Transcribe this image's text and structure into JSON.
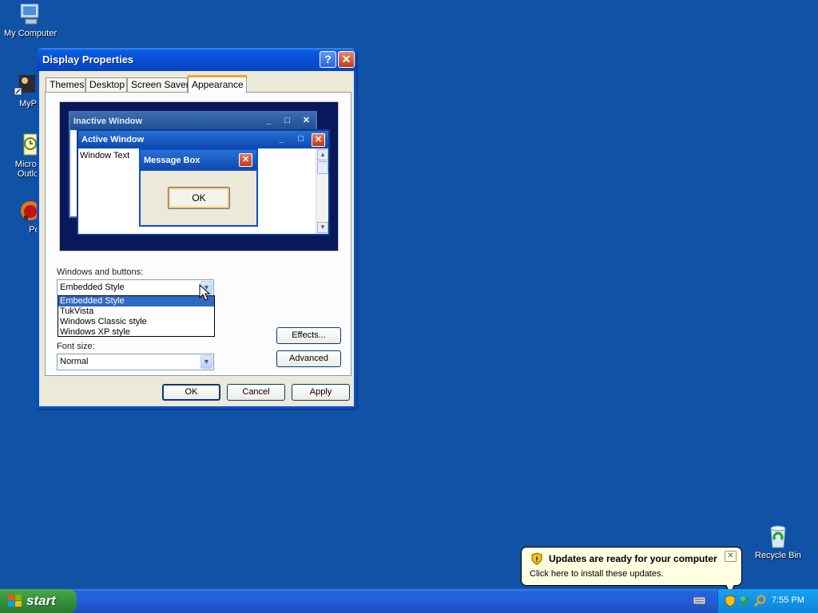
{
  "desktop": {
    "icons": [
      {
        "label": "My Computer",
        "icon": "computer-icon"
      },
      {
        "label": "MyPa",
        "icon": "user-icon"
      },
      {
        "label": "Micros Outlo",
        "icon": "outlook-icon"
      },
      {
        "label": "Peg",
        "icon": "game-icon"
      },
      {
        "label": "Recycle Bin",
        "icon": "recycle-bin-icon"
      }
    ]
  },
  "window": {
    "title": "Display Properties",
    "help_glyph": "?",
    "close_glyph": "✕",
    "tabs": [
      "Themes",
      "Desktop",
      "Screen Saver",
      "Appearance"
    ],
    "active_tab": "Appearance",
    "preview": {
      "inactive_title": "Inactive Window",
      "active_title": "Active Window",
      "window_text": "Window Text",
      "message_title": "Message Box",
      "ok_label": "OK"
    },
    "windows_and_buttons_label": "Windows and buttons:",
    "windows_and_buttons_value": "Embedded Style",
    "dropdown_options": [
      "Embedded Style",
      "TukVista",
      "Windows Classic style",
      "Windows XP style"
    ],
    "selected_option": "Embedded Style",
    "font_size_label": "Font size:",
    "font_size_value": "Normal",
    "effects_label": "Effects...",
    "advanced_label": "Advanced",
    "ok_label": "OK",
    "cancel_label": "Cancel",
    "apply_label": "Apply"
  },
  "taskbar": {
    "start_label": "start",
    "clock": "7:55 PM"
  },
  "balloon": {
    "title": "Updates are ready for your computer",
    "text": "Click here to install these updates.",
    "close_glyph": "✕"
  },
  "colors": {
    "desktop": "#0f52a6",
    "titlebar": "#0751d8",
    "taskbar": "#245edb",
    "start": "#35923a",
    "selection": "#316ac5"
  }
}
